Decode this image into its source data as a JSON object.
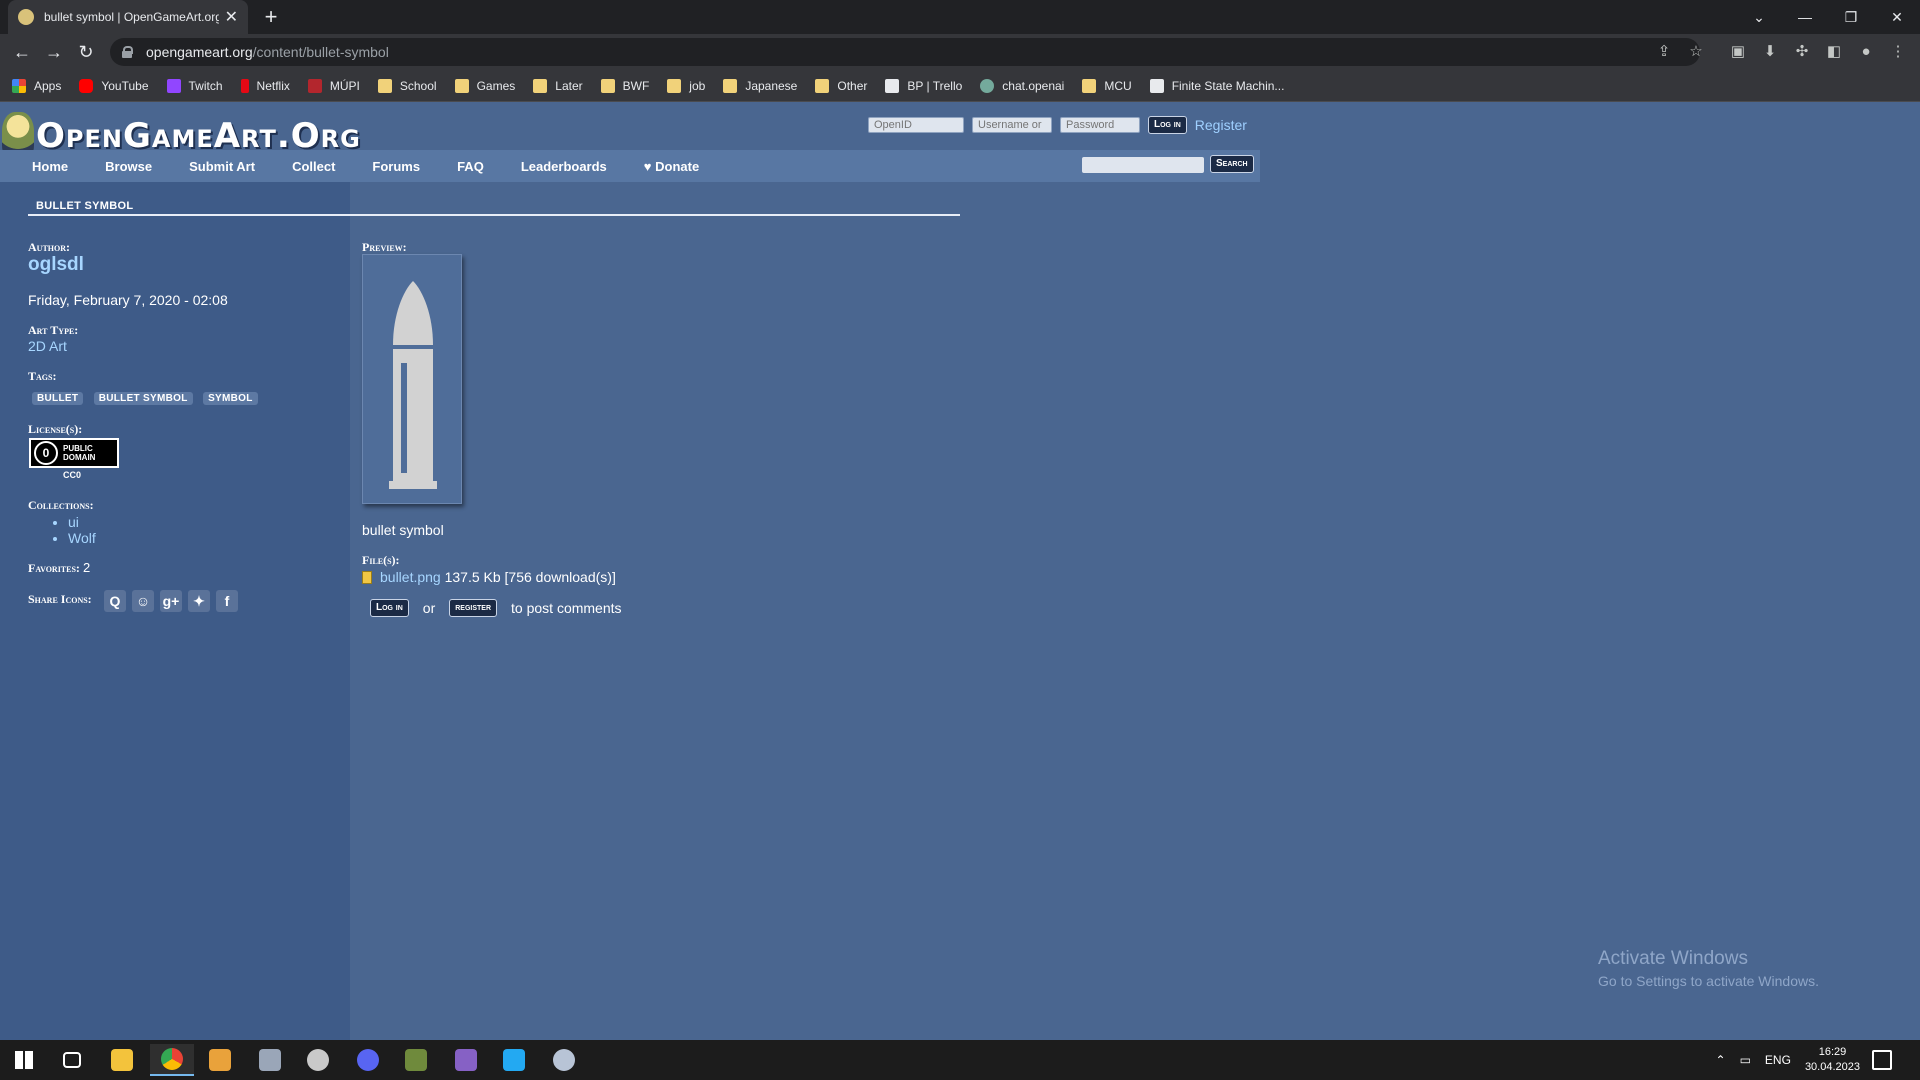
{
  "browser": {
    "tab_title": "bullet symbol | OpenGameArt.org",
    "url_host": "opengameart.org",
    "url_path": "/content/bullet-symbol",
    "bookmarks": [
      "Apps",
      "YouTube",
      "Twitch",
      "Netflix",
      "MÚPI",
      "School",
      "Games",
      "Later",
      "BWF",
      "job",
      "Japanese",
      "Other",
      "BP | Trello",
      "chat.openai",
      "MCU",
      "Finite State Machin..."
    ]
  },
  "site": {
    "logo": "OpenGameArt.Org",
    "login": {
      "openid_placeholder": "OpenID",
      "username_placeholder": "Username or",
      "password_placeholder": "Password",
      "login_label": "Log in",
      "register_label": "Register"
    },
    "nav": [
      "Home",
      "Browse",
      "Submit Art",
      "Collect",
      "Forums",
      "FAQ",
      "Leaderboards",
      "♥ Donate"
    ],
    "search_label": "Search"
  },
  "page": {
    "title": "BULLET SYMBOL",
    "author_label": "Author:",
    "author": "oglsdl",
    "date": "Friday, February 7, 2020 - 02:08",
    "art_type_label": "Art Type:",
    "art_type": "2D Art",
    "tags_label": "Tags:",
    "tags": [
      "BULLET",
      "BULLET SYMBOL",
      "SYMBOL"
    ],
    "license_label": "License(s):",
    "license_badge_line1": "PUBLIC",
    "license_badge_line2": "DOMAIN",
    "license_badge_icon": "0",
    "license_name": "CC0",
    "collections_label": "Collections:",
    "collections": [
      "ui",
      "Wolf"
    ],
    "favorites_label": "Favorites:",
    "favorites": "2",
    "share_label": "Share Icons:",
    "preview_label": "Preview:",
    "caption": "bullet symbol",
    "files_label": "File(s):",
    "file_name": "bullet.png",
    "file_info": "137.5 Kb [756 download(s)]",
    "comment_login": "Log in",
    "comment_or": "or",
    "comment_register": "register",
    "comment_suffix": "to post comments"
  },
  "windows": {
    "watermark_title": "Activate Windows",
    "watermark_sub": "Go to Settings to activate Windows.",
    "lang": "ENG",
    "time": "16:29",
    "date": "30.04.2023"
  }
}
